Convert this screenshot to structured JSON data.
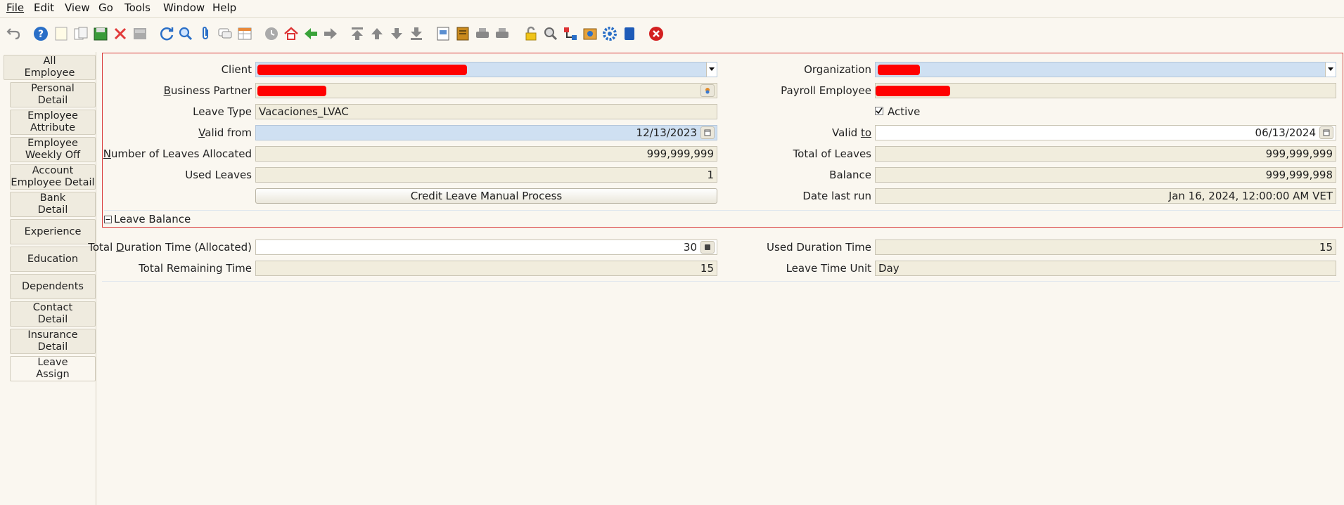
{
  "menu": {
    "file": "File",
    "edit": "Edit",
    "view": "View",
    "go": "Go",
    "tools": "Tools",
    "window": "Window",
    "help": "Help"
  },
  "toolbar_icons": [
    "undo-icon",
    "help-icon",
    "new-record-icon",
    "copy-record-icon",
    "save-icon",
    "delete-icon",
    "grid-toggle-icon",
    "refresh-icon",
    "find-icon",
    "attachment-icon",
    "chat-icon",
    "multi-view-icon",
    "history-icon",
    "home-icon",
    "back-icon",
    "forward-icon",
    "first-record-icon",
    "previous-record-icon",
    "next-record-icon",
    "last-record-icon",
    "report-icon",
    "archive-icon",
    "print-preview-icon",
    "print-icon",
    "lock-icon",
    "zoom-across-icon",
    "workflow-icon",
    "product-info-icon",
    "process-icon",
    "end-window-icon",
    "close-window-icon"
  ],
  "tabs": [
    {
      "label": "All\nEmployee"
    },
    {
      "label": "Personal\nDetail"
    },
    {
      "label": "Employee\nAttribute"
    },
    {
      "label": "Employee\nWeekly Off"
    },
    {
      "label": "Account\nEmployee Detail"
    },
    {
      "label": "Bank\nDetail"
    },
    {
      "label": "Experience"
    },
    {
      "label": "Education"
    },
    {
      "label": "Dependents"
    },
    {
      "label": "Contact\nDetail"
    },
    {
      "label": "Insurance\nDetail"
    },
    {
      "label": "Leave\nAssign"
    }
  ],
  "form": {
    "client_label": "Client",
    "organization_label": "Organization",
    "business_partner_label_u": "B",
    "business_partner_label_rest": "usiness Partner",
    "payroll_employee_label": "Payroll Employee",
    "leave_type_label": "Leave Type",
    "leave_type_value": "Vacaciones_LVAC",
    "active_label": "Active",
    "active_checked": true,
    "valid_from_label_u": "V",
    "valid_from_label_rest": "alid from",
    "valid_from_value": "12/13/2023",
    "valid_to_label_pre": "Valid ",
    "valid_to_label_u": "to",
    "valid_to_value": "06/13/2024",
    "leaves_allocated_label_u": "N",
    "leaves_allocated_label_rest": "umber of Leaves Allocated",
    "leaves_allocated_value": "999,999,999",
    "total_leaves_label": "Total of Leaves",
    "total_leaves_value": "999,999,999",
    "used_leaves_label": "Used Leaves",
    "used_leaves_value": "1",
    "balance_label": "Balance",
    "balance_value": "999,999,998",
    "credit_button_label": "Credit Leave Manual Process",
    "date_last_run_label": "Date last run",
    "date_last_run_value": "Jan 16, 2024, 12:00:00 AM VET",
    "leave_balance_section": "Leave Balance"
  },
  "balance": {
    "total_duration_label_pre": "Total ",
    "total_duration_label_u": "D",
    "total_duration_label_rest": "uration Time (Allocated)",
    "total_duration_value": "30",
    "used_duration_label": "Used Duration Time",
    "used_duration_value": "15",
    "total_remaining_label": "Total Remaining Time",
    "total_remaining_value": "15",
    "leave_time_unit_label": "Leave Time Unit",
    "leave_time_unit_value": "Day"
  },
  "colors": {
    "focus_border": "#d93a3a",
    "redaction": "#ff0000",
    "mandatory_field": "#cfe0f2",
    "readonly_field": "#f1eddd"
  }
}
